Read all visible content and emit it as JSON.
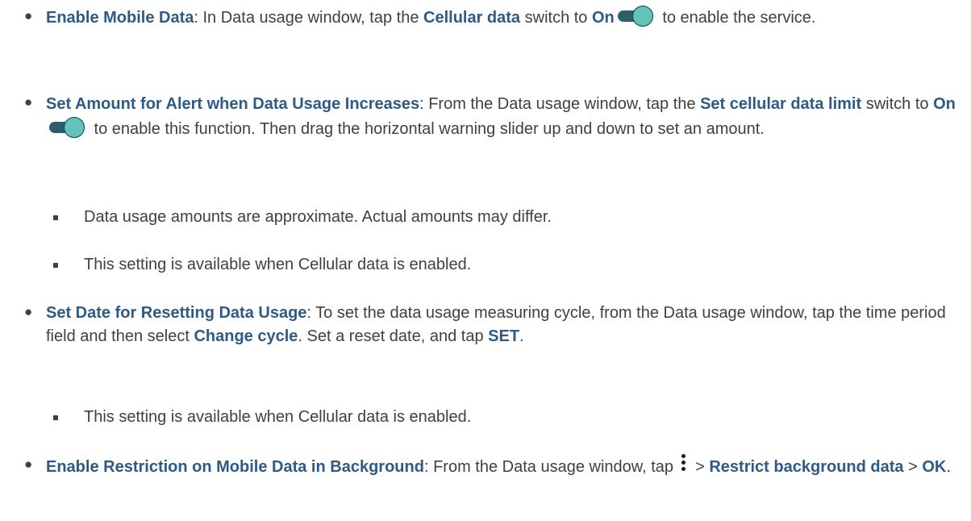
{
  "bullets": [
    {
      "title": "Enable Mobile Data",
      "t1": ": In Data usage window, tap the ",
      "b1": "Cellular data",
      "t2": " switch to ",
      "b2": "On",
      "t3": " to enable the service."
    },
    {
      "title": "Set Amount for Alert when Data Usage Increases",
      "t1": ": From the Data usage window, tap the ",
      "b1": "Set cellular data limit",
      "t2": " switch to ",
      "b2": "On",
      "t3": " to enable this function. Then drag the horizontal warning slider up and down to set an amount.",
      "subs": [
        "Data usage amounts are approximate. Actual amounts may differ.",
        "This setting is available when Cellular data is enabled."
      ]
    },
    {
      "title": "Set Date for Resetting Data Usage",
      "t1": ": To set the data usage measuring cycle, from the Data usage window, tap the time period field and then select ",
      "b1": "Change cycle",
      "t2": ". Set a reset date, and tap ",
      "b2": "SET",
      "t3": ".",
      "subs": [
        "This setting is available when Cellular data is enabled."
      ]
    },
    {
      "title": "Enable Restriction on Mobile Data in Background",
      "t1": ": From the Data usage window, tap ",
      "t2": " > ",
      "b2": "Restrict background data",
      "t3": " > ",
      "b3": "OK",
      "t4": "."
    }
  ],
  "icons": {
    "toggle": "toggle-on-icon",
    "menu": "more-vert-icon"
  },
  "colors": {
    "text": "#404040",
    "bold": "#2d5a86",
    "toggle_track": "#2e5e6e",
    "toggle_knob": "#62c3b9"
  }
}
